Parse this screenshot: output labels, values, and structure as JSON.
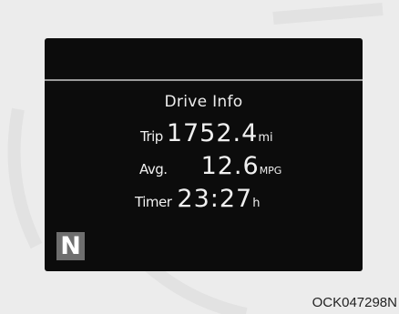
{
  "display": {
    "title": "Drive Info",
    "rows": [
      {
        "label": "Trip",
        "value": "1752.4",
        "unit": "mi"
      },
      {
        "label": "Avg.",
        "value": "12.6",
        "unit": "MPG"
      },
      {
        "label": "Timer",
        "value": "23:27",
        "unit": "h"
      }
    ],
    "gear": "N"
  },
  "figure_code": "OCK047298N",
  "colors": {
    "screen_bg": "#0c0c0c",
    "divider": "#9a9a9a",
    "gear_bg": "#6e6e6e",
    "page_bg": "#ececec"
  }
}
